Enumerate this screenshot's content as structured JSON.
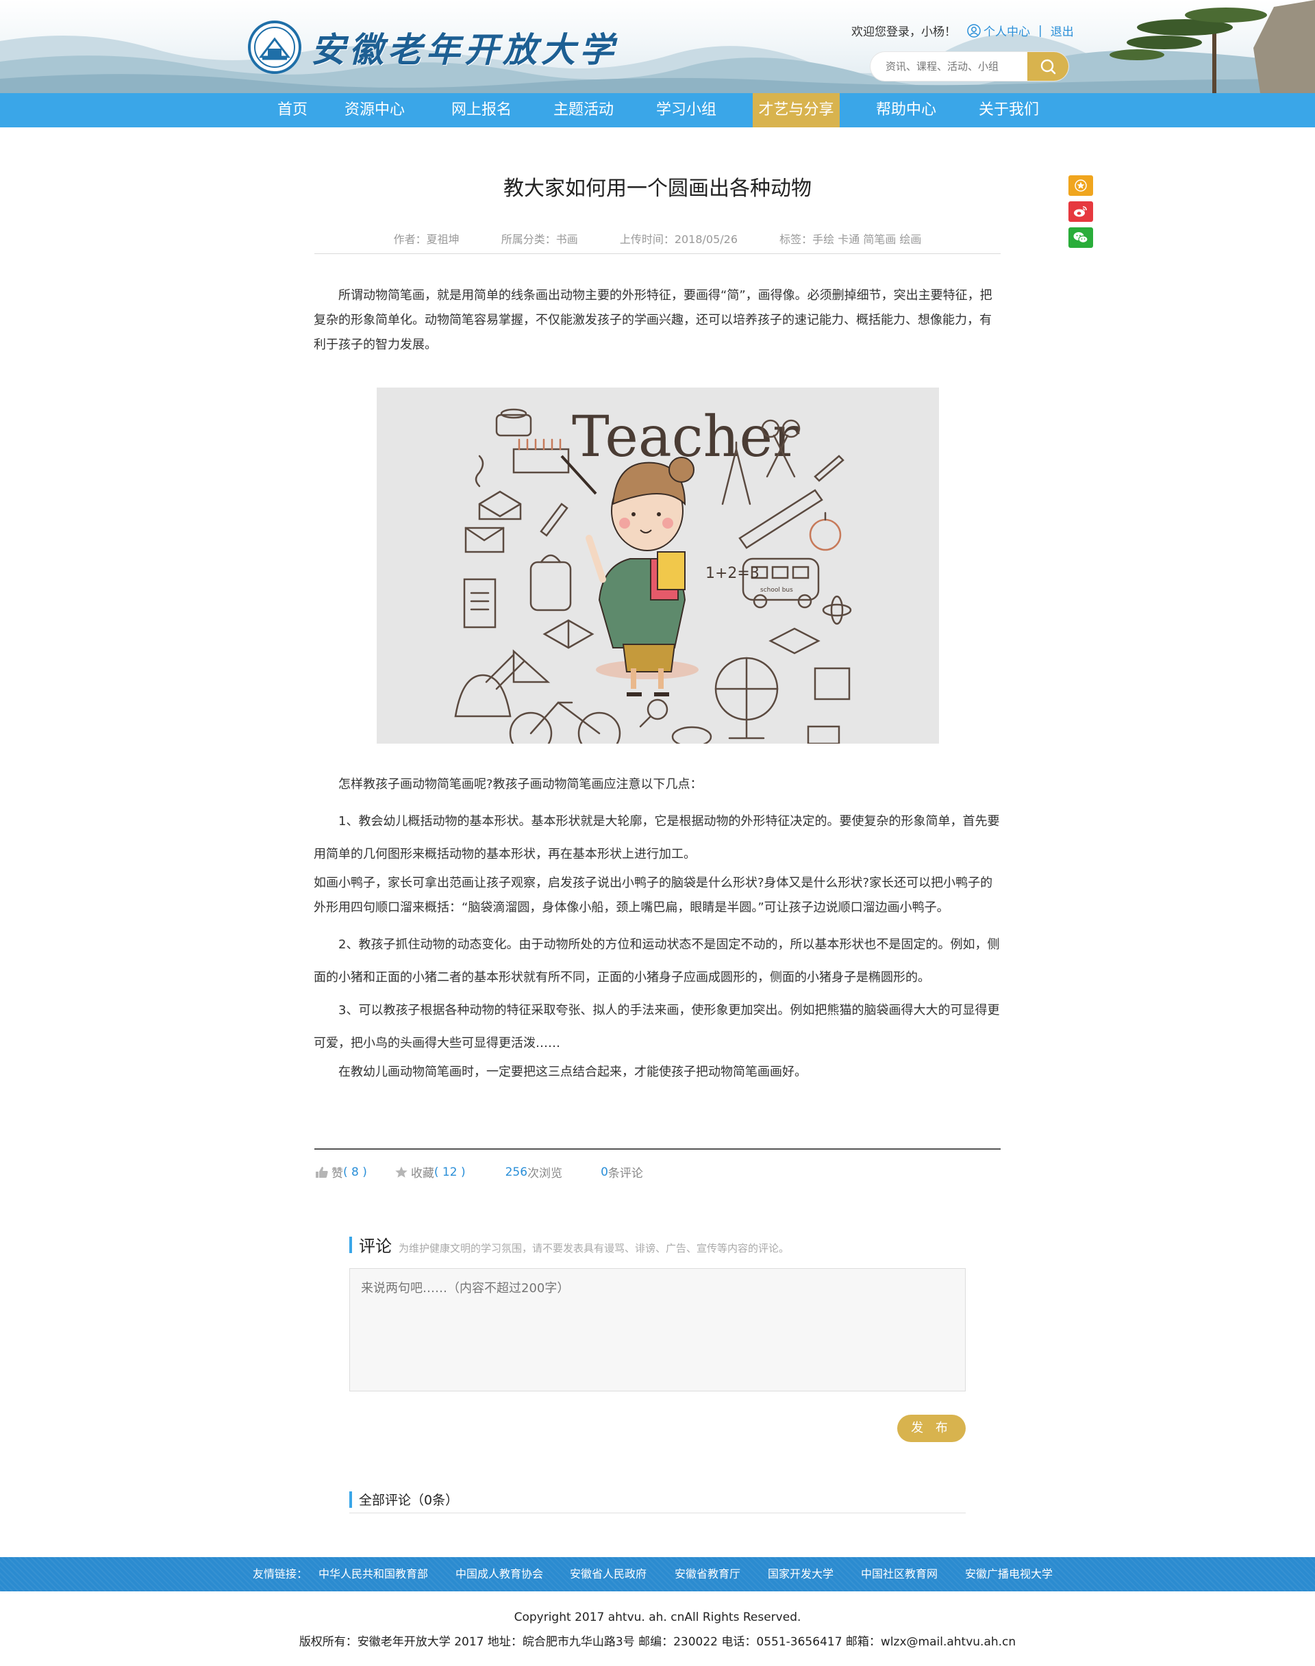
{
  "header": {
    "logo_text": "安徽老年开放大学",
    "welcome": "欢迎您登录，小杨！",
    "user_center": "个人中心",
    "separator": "|",
    "logout": "退出",
    "search_placeholder": "资讯、课程、活动、小组"
  },
  "nav": {
    "items": [
      "首页",
      "资源中心",
      "网上报名",
      "主题活动",
      "学习小组",
      "才艺与分享",
      "帮助中心",
      "关于我们"
    ],
    "active_index": 5
  },
  "article": {
    "title": "教大家如何用一个圆画出各种动物",
    "author": "作者：夏祖坤",
    "category": "所属分类：书画",
    "upload_time": "上传时间：2018/05/26",
    "tags": "标签：手绘 卡通 简笔画 绘画",
    "intro": "所谓动物简笔画，就是用简单的线条画出动物主要的外形特征，要画得“简”，画得像。必须删掉细节，突出主要特征，把复杂的形象简单化。动物简笔容易掌握，不仅能激发孩子的学画兴趣，还可以培养孩子的速记能力、概括能力、想像能力，有利于孩子的智力发展。",
    "image_text": "Teacher",
    "image_math": "1+2=3",
    "image_bus": "school bus",
    "p1": "怎样教孩子画动物简笔画呢?教孩子画动物简笔画应注意以下几点：",
    "p2": "1、教会幼儿概括动物的基本形状。基本形状就是大轮廓，它是根据动物的外形特征决定的。要使复杂的形象简单，首先要用简单的几何图形来概括动物的基本形状，再在基本形状上进行加工。",
    "p3": "如画小鸭子，家长可拿出范画让孩子观察，启发孩子说出小鸭子的脑袋是什么形状?身体又是什么形状?家长还可以把小鸭子的外形用四句顺口溜来概括：“脑袋滴溜圆，身体像小船，颈上嘴巴扁，眼睛是半圆。”可让孩子边说顺口溜边画小鸭子。",
    "p4": "2、教孩子抓住动物的动态变化。由于动物所处的方位和运动状态不是固定不动的，所以基本形状也不是固定的。例如，侧面的小猪和正面的小猪二者的基本形状就有所不同，正面的小猪身子应画成圆形的，侧面的小猪身子是椭圆形的。",
    "p5": "3、可以教孩子根据各种动物的特征采取夸张、拟人的手法来画，使形象更加突出。例如把熊猫的脑袋画得大大的可显得更可爱，把小鸟的头画得大些可显得更活泼……",
    "p6": "在教幼儿画动物简笔画时，一定要把这三点结合起来，才能使孩子把动物简笔画画好。"
  },
  "stats": {
    "like_label": "赞",
    "like_count": "( 8 )",
    "fav_label": "收藏",
    "fav_count": "( 12 )",
    "views_num": "256",
    "views_label": " 次浏览",
    "comments_num": "0",
    "comments_label": " 条评论"
  },
  "comment": {
    "title": "评论",
    "note": "为维护健康文明的学习氛围，请不要发表具有谩骂、诽谤、广告、宣传等内容的评论。",
    "placeholder": "来说两句吧……（内容不超过200字）",
    "publish": "发 布",
    "all_title": "全部评论（0条）"
  },
  "footer": {
    "links_label": "友情链接：",
    "links": [
      "中华人民共和国教育部",
      "中国成人教育协会",
      "安徽省人民政府",
      "安徽省教育厅",
      "国家开发大学",
      "中国社区教育网",
      "安徽广播电视大学"
    ],
    "copyright": "Copyright 2017 ahtvu. ah. cnAll Rights Reserved.",
    "address": "版权所有：安徽老年开放大学 2017 地址：皖合肥市九华山路3号 邮编：230022 电话：0551-3656417 邮箱：wlzx@mail.ahtvu.ah.cn"
  },
  "colors": {
    "nav_blue": "#3aa6e8",
    "gold": "#d8b34e",
    "link_blue": "#2a8fd8",
    "share_fav": "#f0a51e",
    "share_weibo": "#e6393f",
    "share_wechat": "#2aad3a"
  },
  "icons": [
    "user-icon",
    "search-icon",
    "thumb-up-icon",
    "star-icon",
    "favorite-star-icon",
    "weibo-icon",
    "wechat-icon"
  ]
}
